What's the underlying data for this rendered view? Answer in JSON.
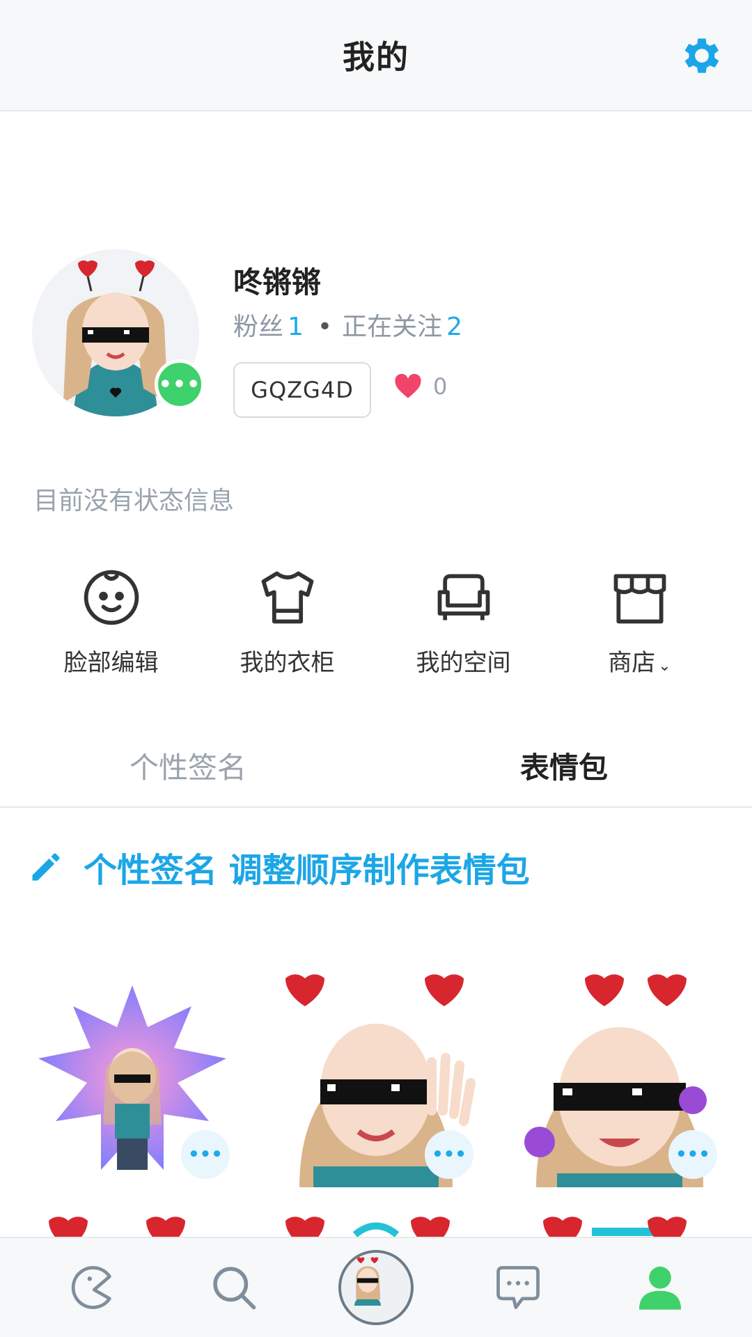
{
  "header": {
    "title": "我的",
    "settings_icon": "gear-icon"
  },
  "profile": {
    "username": "咚锵锵",
    "fans_label": "粉丝",
    "fans_count": "1",
    "following_label": "正在关注",
    "following_count": "2",
    "dot": "•",
    "code": "GQZG4D",
    "likes": "0",
    "more_glyph": "•••"
  },
  "status_text": "目前没有状态信息",
  "actions": [
    {
      "label": "脸部编辑",
      "icon": "face-icon"
    },
    {
      "label": "我的衣柜",
      "icon": "shirt-icon"
    },
    {
      "label": "我的空间",
      "icon": "sofa-icon"
    },
    {
      "label": "商店",
      "icon": "store-icon",
      "chevron": "⌄"
    }
  ],
  "tabs": [
    {
      "label": "个性签名",
      "active": false
    },
    {
      "label": "表情包",
      "active": true
    }
  ],
  "edit_banner": {
    "text": "个性签名 调整顺序制作表情包"
  },
  "colors": {
    "accent": "#1fa9e8",
    "online_green": "#3fd16b",
    "heart": "#f0446b"
  },
  "bottom_nav": [
    {
      "icon": "pacman-icon"
    },
    {
      "icon": "search-icon"
    },
    {
      "icon": "avatar-icon"
    },
    {
      "icon": "chat-icon"
    },
    {
      "icon": "profile-icon",
      "active": true
    }
  ],
  "sticker_more_glyph": "•••"
}
